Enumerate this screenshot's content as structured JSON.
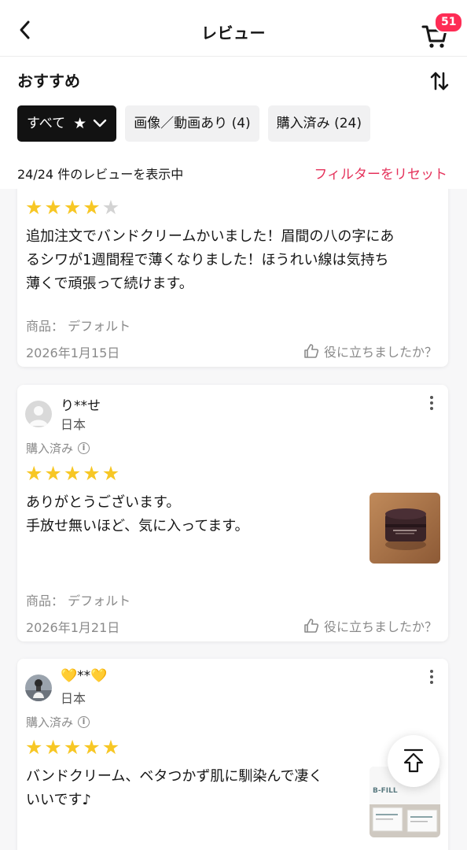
{
  "header": {
    "title": "レビュー",
    "cart_badge": "51"
  },
  "sort": {
    "label": "おすすめ"
  },
  "filters": [
    {
      "label": "すべて"
    },
    {
      "label": "画像／動画あり (4)"
    },
    {
      "label": "購入済み (24)"
    }
  ],
  "summary": {
    "count_text": "24/24 件のレビューを表示中",
    "reset_label": "フィルターをリセット"
  },
  "colors": {
    "accent": "#fe2c55",
    "reset": "#e5325b",
    "star": "#f7c725"
  },
  "reviews": [
    {
      "rating": 4,
      "text_lines": [
        "追加注文でバンドクリームかいました！眉間の八の字にあ",
        "るシワが1週間程で薄くなりました！ほうれい線は気持ち",
        "薄くで頑張って続けます。"
      ],
      "variant": "商品： デフォルト",
      "date": "2026年1月15日",
      "helpful": "役に立ちましたか？"
    },
    {
      "user": "り**せ",
      "country": "日本",
      "purchased": "購入済み",
      "rating": 5,
      "text_lines": [
        "ありがとうございます。",
        "手放せ無いほど、気に入ってます。"
      ],
      "variant": "商品： デフォルト",
      "date": "2026年1月21日",
      "helpful": "役に立ちましたか？"
    },
    {
      "user": "💛**💛",
      "country": "日本",
      "purchased": "購入済み",
      "rating": 5,
      "text_lines": [
        "バンドクリーム、ベタつかず肌に馴染んで凄く",
        "いいです♪"
      ],
      "thumb_brand": "B-FILL"
    }
  ]
}
